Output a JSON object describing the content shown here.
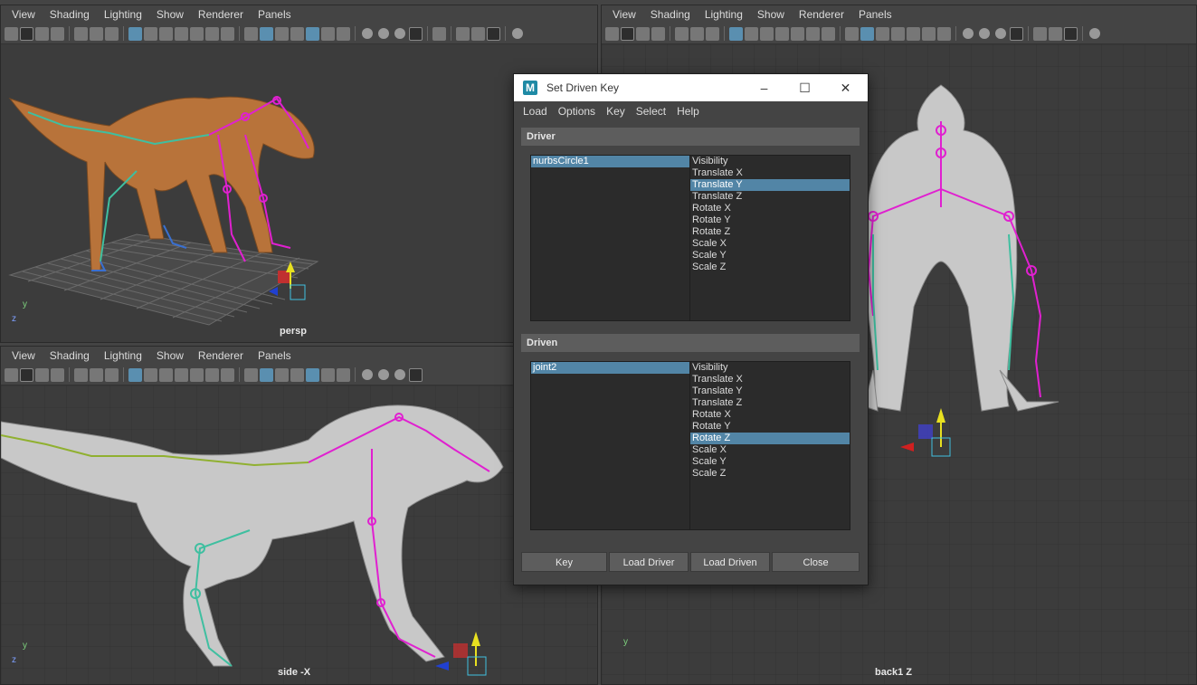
{
  "viewports": {
    "persp": {
      "menu": [
        "View",
        "Shading",
        "Lighting",
        "Show",
        "Renderer",
        "Panels"
      ],
      "label": "persp"
    },
    "side": {
      "menu": [
        "View",
        "Shading",
        "Lighting",
        "Show",
        "Renderer",
        "Panels"
      ],
      "label": "side -X"
    },
    "back": {
      "menu": [
        "View",
        "Shading",
        "Lighting",
        "Show",
        "Renderer",
        "Panels"
      ],
      "label": "back1 Z"
    }
  },
  "axis": {
    "y": "y",
    "z": "z"
  },
  "dialog": {
    "title": "Set Driven Key",
    "logo": "M",
    "menu": [
      "Load",
      "Options",
      "Key",
      "Select",
      "Help"
    ],
    "driver": {
      "header": "Driver",
      "objects": [
        "nurbsCircle1"
      ],
      "attributes": [
        "Visibility",
        "Translate X",
        "Translate Y",
        "Translate Z",
        "Rotate X",
        "Rotate Y",
        "Rotate Z",
        "Scale X",
        "Scale Y",
        "Scale Z"
      ],
      "selected_attribute": "Translate Y"
    },
    "driven": {
      "header": "Driven",
      "objects": [
        "joint2"
      ],
      "attributes": [
        "Visibility",
        "Translate X",
        "Translate Y",
        "Translate Z",
        "Rotate X",
        "Rotate Y",
        "Rotate Z",
        "Scale X",
        "Scale Y",
        "Scale Z"
      ],
      "selected_attribute": "Rotate Z"
    },
    "buttons": {
      "key": "Key",
      "load_driver": "Load Driver",
      "load_driven": "Load Driven",
      "close": "Close"
    }
  },
  "colors": {
    "selection": "#5285a6",
    "skeleton": "#e020d0",
    "creature_orange": "#b8733a",
    "creature_gray": "#c8c8c8"
  }
}
